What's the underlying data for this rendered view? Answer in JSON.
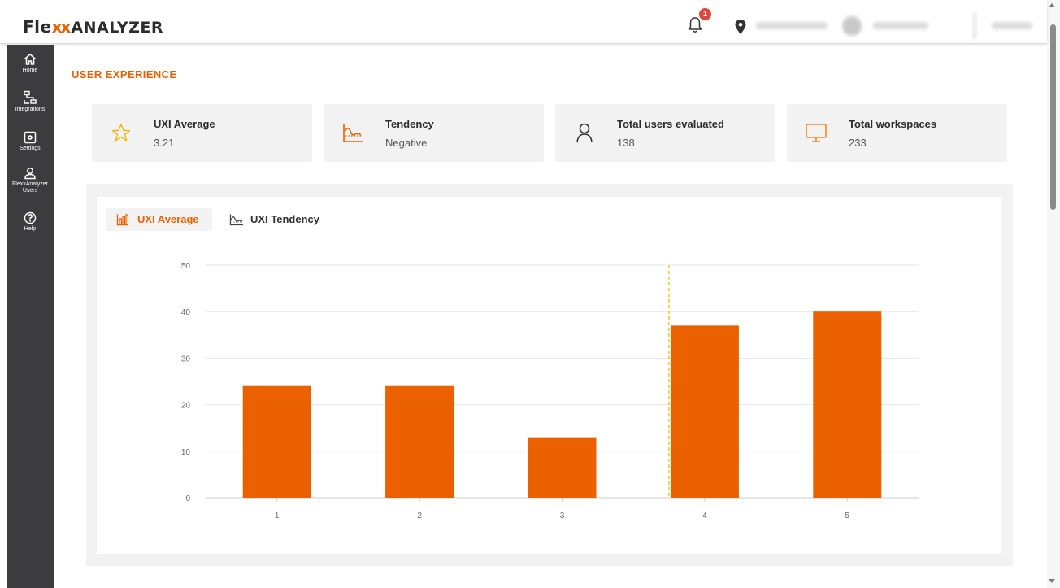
{
  "app": {
    "logo": {
      "part1": "Fle",
      "part2": "xx",
      "part3": "ANALYZER"
    },
    "notifications": {
      "count": "1"
    }
  },
  "sidebar": {
    "items": [
      {
        "label": "Home",
        "icon": "home-icon"
      },
      {
        "label": "Integrations",
        "icon": "integrations-icon"
      },
      {
        "label": "Settings",
        "icon": "settings-icon"
      },
      {
        "label": "FlexxAnalyzer Users",
        "icon": "user-icon"
      },
      {
        "label": "Help",
        "icon": "help-icon"
      }
    ]
  },
  "page": {
    "title": "USER EXPERIENCE"
  },
  "cards": [
    {
      "title": "UXI Average",
      "value": "3.21",
      "icon": "star-icon"
    },
    {
      "title": "Tendency",
      "value": "Negative",
      "icon": "tendency-chart-icon"
    },
    {
      "title": "Total users evaluated",
      "value": "138",
      "icon": "user-icon"
    },
    {
      "title": "Total workspaces",
      "value": "233",
      "icon": "monitor-icon"
    }
  ],
  "tabs": [
    {
      "label": "UXI Average",
      "active": true,
      "icon": "bar-chart-icon"
    },
    {
      "label": "UXI Tendency",
      "active": false,
      "icon": "tendency-chart-icon"
    }
  ],
  "colors": {
    "accent": "#eb6100",
    "marker": "#f5c518",
    "sidebar": "#3c3c3e"
  },
  "chart_data": {
    "type": "bar",
    "categories": [
      "1",
      "2",
      "3",
      "4",
      "5"
    ],
    "values": [
      24,
      24,
      13,
      37,
      40
    ],
    "ylim": [
      0,
      50
    ],
    "yticks": [
      0,
      10,
      20,
      30,
      40,
      50
    ],
    "marker_category": "4",
    "grid": true
  }
}
